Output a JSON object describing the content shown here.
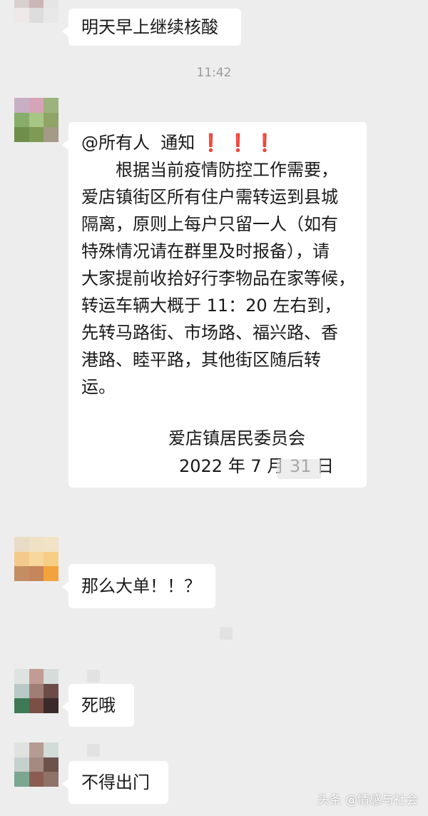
{
  "messages": {
    "m1": {
      "text": "明天早上继续核酸"
    },
    "timestamp": "11:42",
    "m2": {
      "mention": "@所有人",
      "notice": "通知",
      "excl": "❗",
      "lines": [
        "　　根据当前疫情防控工作需要，",
        "爱店镇街区所有住户需转运到县城",
        "隔离，原则上每户只留一人（如有",
        "特殊情况请在群里及时报备），请",
        "大家提前收拾好行李物品在家等候，",
        "转运车辆大概于 11：20 左右到，",
        "先转马路街、市场路、福兴路、香",
        "港路、睦平路，其他街区随后转",
        "运。"
      ],
      "signature": "爱店镇居民委员会",
      "date": "2022 年 7 月 31 日"
    },
    "m3": {
      "text": "那么大单！！？"
    },
    "m4": {
      "text": "死哦"
    },
    "m5": {
      "text": "不得出门"
    }
  },
  "watermark": "头条 @情感与社会",
  "colors": {
    "chat_bg": "#ededed",
    "bubble": "#ffffff",
    "timestamp": "#9a9a9a",
    "emphasis": "#e0241b"
  }
}
